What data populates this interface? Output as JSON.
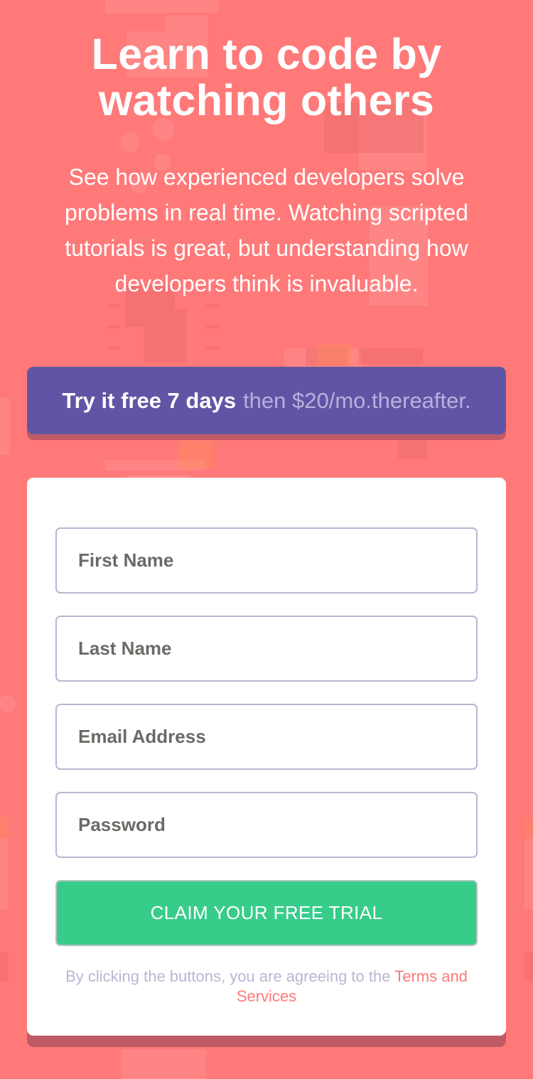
{
  "hero": {
    "title": "Learn to code by watching others",
    "description": "See how experienced developers solve problems in real time. Watching scripted tutorials is great, but understanding how developers think is invaluable."
  },
  "offer": {
    "highlight": "Try it free 7 days",
    "rest": "then $20/mo.thereafter."
  },
  "form": {
    "first_name": {
      "placeholder": "First Name",
      "value": ""
    },
    "last_name": {
      "placeholder": "Last Name",
      "value": ""
    },
    "email": {
      "placeholder": "Email Address",
      "value": ""
    },
    "password": {
      "placeholder": "Password",
      "value": ""
    },
    "submit_label": "CLAIM YOUR FREE TRIAL",
    "terms_text": "By clicking the buttons, you are agreeing to the",
    "terms_link": "Terms and Services"
  },
  "colors": {
    "background": "#ff7979",
    "offer_bg": "#6055a5",
    "button_bg": "#38cc8b",
    "accent": "#ff7979",
    "muted": "#b9b6d3"
  }
}
